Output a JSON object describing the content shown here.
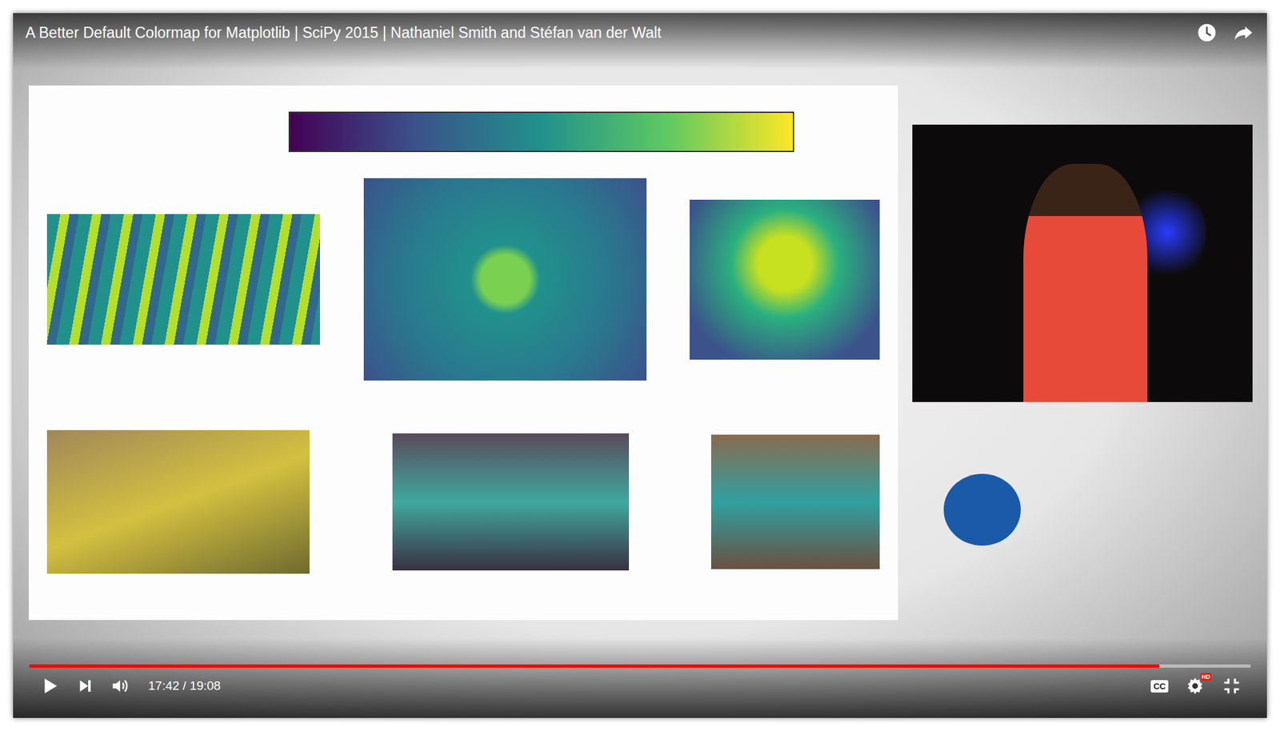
{
  "video": {
    "title": "A Better Default Colormap for Matplotlib | SciPy 2015 | Nathaniel Smith and Stéfan van der Walt",
    "playing": false,
    "progress": {
      "level": 0.925
    },
    "time": "17:42 / 19:08"
  },
  "controls": {
    "cc_label": "CC",
    "hd_badge": "HD"
  }
}
